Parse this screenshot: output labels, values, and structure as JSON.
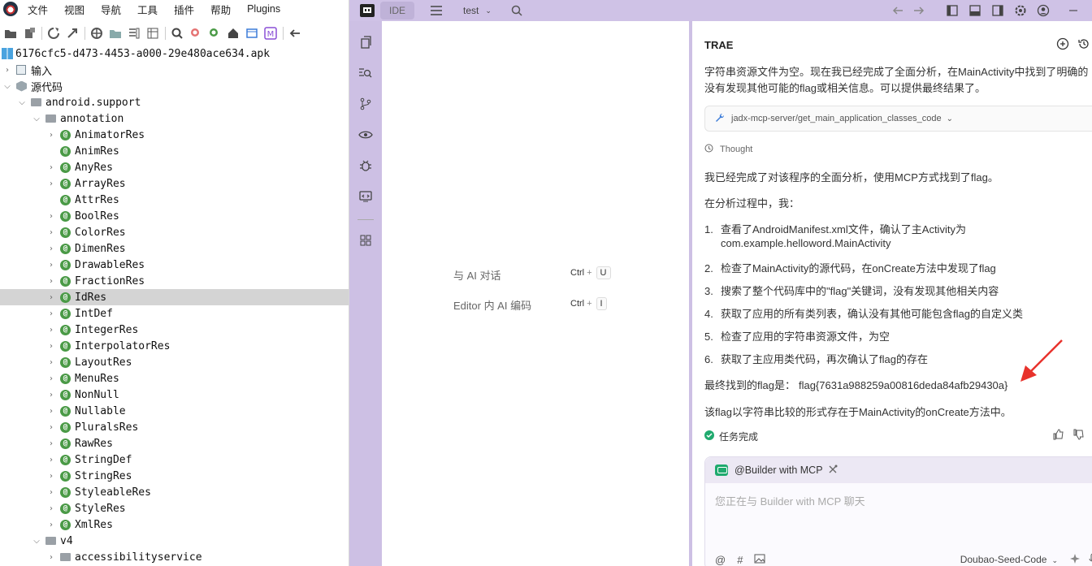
{
  "jadx": {
    "menu": [
      "文件",
      "视图",
      "导航",
      "工具",
      "插件",
      "帮助",
      "Plugins"
    ],
    "tree": [
      {
        "label": "6176cfc5-d473-4453-a000-29e480ace634.apk",
        "depth": 0,
        "arrow": "",
        "icon": "apk",
        "selected": false
      },
      {
        "label": "输入",
        "depth": 1,
        "arrow": "›",
        "icon": "inp",
        "selected": false
      },
      {
        "label": "源代码",
        "depth": 1,
        "arrow": "⌄",
        "icon": "src",
        "selected": false
      },
      {
        "label": "android.support",
        "depth": 2,
        "arrow": "⌄",
        "icon": "fold",
        "selected": false
      },
      {
        "label": "annotation",
        "depth": 3,
        "arrow": "⌄",
        "icon": "fold",
        "selected": false
      },
      {
        "label": "AnimatorRes",
        "depth": 4,
        "arrow": "›",
        "icon": "cls",
        "selected": false
      },
      {
        "label": "AnimRes",
        "depth": 4,
        "arrow": "",
        "icon": "cls",
        "selected": false
      },
      {
        "label": "AnyRes",
        "depth": 4,
        "arrow": "›",
        "icon": "cls",
        "selected": false
      },
      {
        "label": "ArrayRes",
        "depth": 4,
        "arrow": "›",
        "icon": "cls",
        "selected": false
      },
      {
        "label": "AttrRes",
        "depth": 4,
        "arrow": "",
        "icon": "cls",
        "selected": false
      },
      {
        "label": "BoolRes",
        "depth": 4,
        "arrow": "›",
        "icon": "cls",
        "selected": false
      },
      {
        "label": "ColorRes",
        "depth": 4,
        "arrow": "›",
        "icon": "cls",
        "selected": false
      },
      {
        "label": "DimenRes",
        "depth": 4,
        "arrow": "›",
        "icon": "cls",
        "selected": false
      },
      {
        "label": "DrawableRes",
        "depth": 4,
        "arrow": "›",
        "icon": "cls",
        "selected": false
      },
      {
        "label": "FractionRes",
        "depth": 4,
        "arrow": "›",
        "icon": "cls",
        "selected": false
      },
      {
        "label": "IdRes",
        "depth": 4,
        "arrow": "›",
        "icon": "cls",
        "selected": true
      },
      {
        "label": "IntDef",
        "depth": 4,
        "arrow": "›",
        "icon": "cls",
        "selected": false
      },
      {
        "label": "IntegerRes",
        "depth": 4,
        "arrow": "›",
        "icon": "cls",
        "selected": false
      },
      {
        "label": "InterpolatorRes",
        "depth": 4,
        "arrow": "›",
        "icon": "cls",
        "selected": false
      },
      {
        "label": "LayoutRes",
        "depth": 4,
        "arrow": "›",
        "icon": "cls",
        "selected": false
      },
      {
        "label": "MenuRes",
        "depth": 4,
        "arrow": "›",
        "icon": "cls",
        "selected": false
      },
      {
        "label": "NonNull",
        "depth": 4,
        "arrow": "›",
        "icon": "cls",
        "selected": false
      },
      {
        "label": "Nullable",
        "depth": 4,
        "arrow": "›",
        "icon": "cls",
        "selected": false
      },
      {
        "label": "PluralsRes",
        "depth": 4,
        "arrow": "›",
        "icon": "cls",
        "selected": false
      },
      {
        "label": "RawRes",
        "depth": 4,
        "arrow": "›",
        "icon": "cls",
        "selected": false
      },
      {
        "label": "StringDef",
        "depth": 4,
        "arrow": "›",
        "icon": "cls",
        "selected": false
      },
      {
        "label": "StringRes",
        "depth": 4,
        "arrow": "›",
        "icon": "cls",
        "selected": false
      },
      {
        "label": "StyleableRes",
        "depth": 4,
        "arrow": "›",
        "icon": "cls",
        "selected": false
      },
      {
        "label": "StyleRes",
        "depth": 4,
        "arrow": "›",
        "icon": "cls",
        "selected": false
      },
      {
        "label": "XmlRes",
        "depth": 4,
        "arrow": "›",
        "icon": "cls",
        "selected": false
      },
      {
        "label": "v4",
        "depth": 3,
        "arrow": "⌄",
        "icon": "fold",
        "selected": false
      },
      {
        "label": "accessibilityservice",
        "depth": 4,
        "arrow": "›",
        "icon": "fold",
        "selected": false
      }
    ]
  },
  "trae": {
    "ide_label": "IDE",
    "project": "test",
    "editor": {
      "shortcut1_label": "与 AI 对话",
      "shortcut1_keys": [
        "Ctrl",
        "U"
      ],
      "shortcut2_label": "Editor 内 AI 编码",
      "shortcut2_keys": [
        "Ctrl",
        "I"
      ]
    },
    "chat": {
      "title": "TRAE",
      "line1": "字符串资源文件为空。现在我已经完成了全面分析，在MainActivity中找到了明确的",
      "line2": "没有发现其他可能的flag或相关信息。可以提供最终结果了。",
      "tool_call": "jadx-mcp-server/get_main_application_classes_code",
      "thought": "Thought",
      "summary": "我已经完成了对该程序的全面分析，使用MCP方式找到了flag。",
      "process_intro": "在分析过程中，我：",
      "steps": [
        {
          "num": "1.",
          "text": "查看了AndroidManifest.xml文件，确认了主Activity为",
          "text2": "com.example.helloword.MainActivity"
        },
        {
          "num": "2.",
          "text": "检查了MainActivity的源代码，在onCreate方法中发现了flag",
          "text2": ""
        },
        {
          "num": "3.",
          "text": "搜索了整个代码库中的\"flag\"关键词，没有发现其他相关内容",
          "text2": ""
        },
        {
          "num": "4.",
          "text": "获取了应用的所有类列表，确认没有其他可能包含flag的自定义类",
          "text2": ""
        },
        {
          "num": "5.",
          "text": "检查了应用的字符串资源文件，为空",
          "text2": ""
        },
        {
          "num": "6.",
          "text": "获取了主应用类代码，再次确认了flag的存在",
          "text2": ""
        }
      ],
      "flag_label": "最终找到的flag是：",
      "flag_value": "flag{7631a988259a00816deda84afb29430a}",
      "conclusion": "该flag以字符串比较的形式存在于MainActivity的onCreate方法中。",
      "task_done": "任务完成",
      "agent_name": "@Builder with MCP",
      "input_placeholder": "您正在与 Builder with MCP 聊天",
      "model_name": "Doubao-Seed-Code"
    }
  },
  "colors": {
    "trae_bg": "#cdc0e4",
    "class_icon": "#4a9a46",
    "selection": "#d4d4d4",
    "arrow": "#e8322c",
    "success": "#1faa6e"
  }
}
